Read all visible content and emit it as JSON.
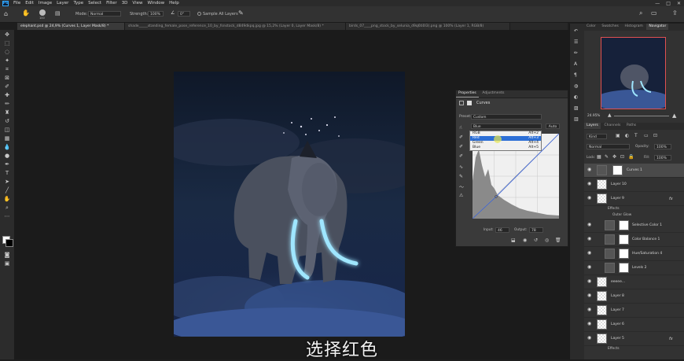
{
  "app": {
    "logo": "Ps"
  },
  "menu": [
    "File",
    "Edit",
    "Image",
    "Layer",
    "Type",
    "Select",
    "Filter",
    "3D",
    "View",
    "Window",
    "Help"
  ],
  "options": {
    "mode_label": "Mode:",
    "mode_value": "Normal",
    "strength_label": "Strength:",
    "strength_value": "100%",
    "angle_value": "0°",
    "sample_all_layers": "Sample All Layers",
    "brush_size": "100"
  },
  "tabs": [
    "elephant.psd @ 24,9% (Curves 1, Layer Mask/8) *",
    "shade_____standing_female_pose_reference_10_by_fsnstock_d849dkpq.jpg @ 15,2% (Layer 0, Layer Mask/8) *",
    "birds_07____png_stock_by_selunia_d9q6ti0l3).png @ 100% (Layer 1, RGB/8)"
  ],
  "properties": {
    "tabs": [
      "Properties",
      "Adjustments"
    ],
    "title": "Curves",
    "preset_label": "Preset:",
    "preset_value": "Custom",
    "channel_value": "Blue",
    "auto_label": "Auto",
    "input_label": "Input:",
    "input_value": "46",
    "output_label": "Output:",
    "output_value": "78",
    "channels": [
      {
        "name": "RGB",
        "shortcut": "Alt+2"
      },
      {
        "name": "Red",
        "shortcut": "Alt+3"
      },
      {
        "name": "Green",
        "shortcut": "Alt+4"
      },
      {
        "name": "Blue",
        "shortcut": "Alt+5"
      }
    ],
    "selected_channel": "Red"
  },
  "navigator": {
    "tabs": [
      "Color",
      "Swatches",
      "Histogram",
      "Navigator"
    ],
    "zoom": "24.95%"
  },
  "layers_panel": {
    "tabs": [
      "Layers",
      "Channels",
      "Paths"
    ],
    "kind_label": "Kind",
    "blend_mode": "Normal",
    "opacity_label": "Opacity:",
    "opacity_value": "100%",
    "lock_label": "Lock:",
    "fill_label": "Fill:",
    "fill_value": "100%",
    "layers": [
      {
        "name": "Curves 1",
        "type": "adjust",
        "selected": true
      },
      {
        "name": "Layer 10",
        "type": "pixel"
      },
      {
        "name": "Layer 9",
        "type": "pixel",
        "fx": true
      },
      {
        "name": "Selective Color 1",
        "type": "adjust"
      },
      {
        "name": "Color Balance 1",
        "type": "adjust"
      },
      {
        "name": "Hue/Saturation 4",
        "type": "adjust"
      },
      {
        "name": "Levels 2",
        "type": "adjust"
      },
      {
        "name": "eeeee...",
        "type": "pixel"
      },
      {
        "name": "Layer 8",
        "type": "pixel"
      },
      {
        "name": "Layer 7",
        "type": "pixel"
      },
      {
        "name": "Layer 6",
        "type": "pixel"
      },
      {
        "name": "Layer 5",
        "type": "pixel",
        "fx": true
      }
    ],
    "effects_label": "Effects",
    "outer_glow_label": "Outer Glow"
  },
  "subtitle": "选择红色",
  "colors": {
    "accent_glow": "#7fd8ff",
    "menu_bg": "#2b2b2b",
    "panel_bg": "#3a3a3a",
    "selection": "#2c6fd6"
  }
}
